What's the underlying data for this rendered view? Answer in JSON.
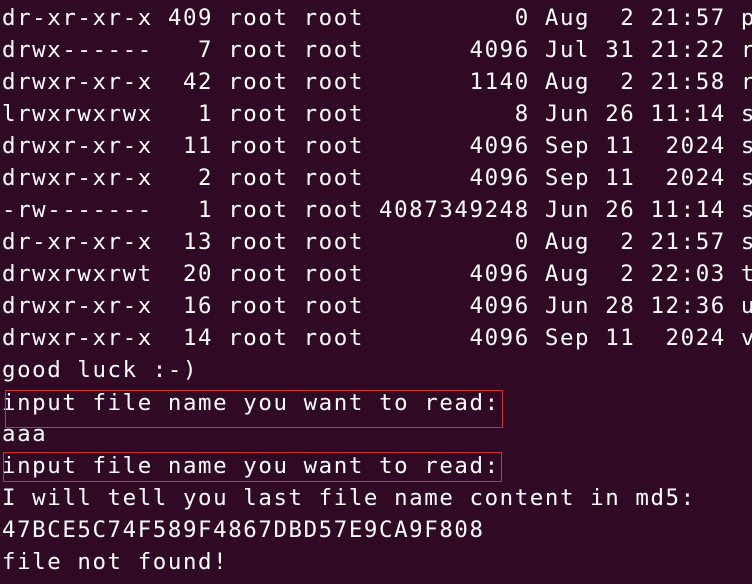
{
  "listing": [
    "dr-xr-xr-x 409 root root          0 Aug  2 21:57 p",
    "drwx------   7 root root       4096 Jul 31 21:22 r",
    "drwxr-xr-x  42 root root       1140 Aug  2 21:58 r",
    "lrwxrwxrwx   1 root root          8 Jun 26 11:14 s",
    "drwxr-xr-x  11 root root       4096 Sep 11  2024 s",
    "drwxr-xr-x   2 root root       4096 Sep 11  2024 s",
    "-rw-------   1 root root 4087349248 Jun 26 11:14 s",
    "dr-xr-xr-x  13 root root          0 Aug  2 21:57 s",
    "drwxrwxrwt  20 root root       4096 Aug  2 22:03 t",
    "drwxr-xr-x  16 root root       4096 Jun 28 12:36 u",
    "drwxr-xr-x  14 root root       4096 Sep 11  2024 v"
  ],
  "output": {
    "good_luck": "good luck :-)",
    "prompt_1": "input file name you want to read:",
    "user_input": "aaa",
    "prompt_2": "input file name you want to read:",
    "md5_notice": "I will tell you last file name content in md5:",
    "md5_hash": "47BCE5C74F589F4867DBD57E9CA9F808",
    "not_found": "file not found!"
  },
  "colors": {
    "background": "#300a24",
    "foreground": "#ffffff",
    "highlight_border": "#d0323a"
  }
}
